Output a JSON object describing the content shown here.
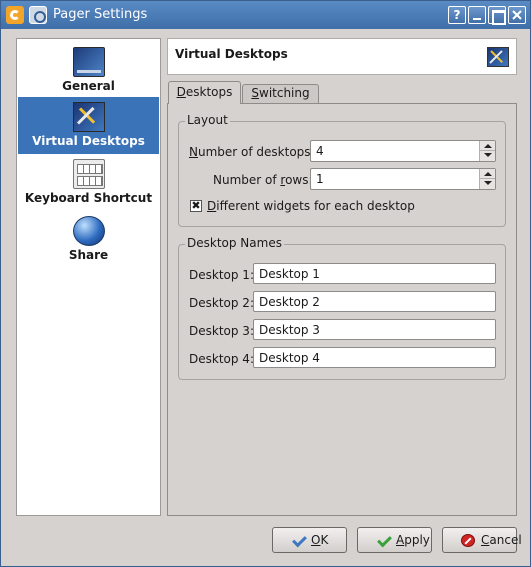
{
  "window": {
    "title": "Pager Settings",
    "help_glyph": "?"
  },
  "sidebar": {
    "items": [
      {
        "label": "General",
        "icon": "desktop-icon",
        "active": false
      },
      {
        "label": "Virtual Desktops",
        "icon": "virtual-desktops-icon",
        "active": true
      },
      {
        "label": "Keyboard Shortcut",
        "icon": "keyboard-icon",
        "active": false
      },
      {
        "label": "Share",
        "icon": "globe-icon",
        "active": false
      }
    ]
  },
  "header": {
    "title": "Virtual Desktops"
  },
  "tabs": [
    {
      "prefix": "",
      "accel": "D",
      "rest": "esktops",
      "active": true
    },
    {
      "prefix": "",
      "accel": "S",
      "rest": "witching",
      "active": false
    }
  ],
  "layout_group": {
    "title": "Layout",
    "num_desktops": {
      "prefix": "",
      "accel": "N",
      "rest": "umber of desktops:",
      "value": "4"
    },
    "num_rows": {
      "prefix": "Number of ",
      "accel": "r",
      "rest": "ows:",
      "value": "1"
    },
    "different_widgets": {
      "prefix": "",
      "accel": "D",
      "rest": "ifferent widgets for each desktop",
      "checked": true,
      "mark": "✖"
    }
  },
  "names_group": {
    "title": "Desktop Names",
    "rows": [
      {
        "label": "Desktop 1:",
        "value": "Desktop 1"
      },
      {
        "label": "Desktop 2:",
        "value": "Desktop 2"
      },
      {
        "label": "Desktop 3:",
        "value": "Desktop 3"
      },
      {
        "label": "Desktop 4:",
        "value": "Desktop 4"
      }
    ]
  },
  "buttons": {
    "ok": {
      "prefix": "",
      "accel": "O",
      "rest": "K"
    },
    "apply": {
      "prefix": "",
      "accel": "A",
      "rest": "pply"
    },
    "cancel": {
      "prefix": "",
      "accel": "C",
      "rest": "ancel"
    }
  },
  "colors": {
    "titlebar": "#4a7bb7",
    "selection": "#3a73b8",
    "background": "#d6d2d0"
  }
}
